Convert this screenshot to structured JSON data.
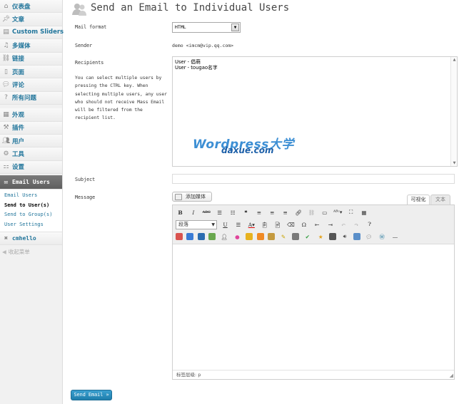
{
  "sidebar": {
    "items": [
      {
        "label": "仪表盘",
        "icon": "dashboard-icon"
      },
      {
        "label": "文章",
        "icon": "pin-icon"
      },
      {
        "label": "Custom Sliders",
        "icon": "slider-icon"
      },
      {
        "label": "多媒体",
        "icon": "media-icon"
      },
      {
        "label": "链接",
        "icon": "link-icon"
      },
      {
        "label": "页面",
        "icon": "page-icon"
      },
      {
        "label": "评论",
        "icon": "comment-icon"
      },
      {
        "label": "所有问题",
        "icon": "question-icon"
      },
      {
        "label": "外观",
        "icon": "appearance-icon"
      },
      {
        "label": "插件",
        "icon": "plugin-icon"
      },
      {
        "label": "用户",
        "icon": "users-icon"
      },
      {
        "label": "工具",
        "icon": "tools-icon"
      },
      {
        "label": "设置",
        "icon": "settings-icon"
      }
    ],
    "active_menu": {
      "label": "Email Users",
      "icon": "mail-icon"
    },
    "submenu": [
      "Email Users",
      "Send to User(s)",
      "Send to Group(s)",
      "User Settings"
    ],
    "submenu_current": 1,
    "extra_item": {
      "label": "cmhello",
      "icon": "cross-icon"
    },
    "collapse_label": "收起菜单"
  },
  "page": {
    "title": "Send an Email to Individual Users",
    "mail_format_label": "Mail format",
    "mail_format_value": "HTML",
    "sender_label": "Sender",
    "sender_value": "demo <imcm@vip.qq.com>",
    "recipients_label": "Recipients",
    "recipients_help": "You can select multiple users by pressing the CTRL key. When selecting multiple users, any user who should not receive Mass Email will be filtered from the recipient list.",
    "recipients": [
      "User - 倡萌",
      "User - tougao名字"
    ],
    "watermark_main": "Wordpress大学",
    "watermark_sub": "daxue.com",
    "subject_label": "Subject",
    "message_label": "Message",
    "add_media_label": "添加媒体",
    "tab_visual": "可视化",
    "tab_text": "文本",
    "paragraph_format": "段落",
    "status_path": "标签层级: p",
    "send_button": "Send Email »"
  },
  "colors": {
    "link": "#21759b",
    "active_menu": "#6d6d6d",
    "button": "#2a8dbf"
  }
}
